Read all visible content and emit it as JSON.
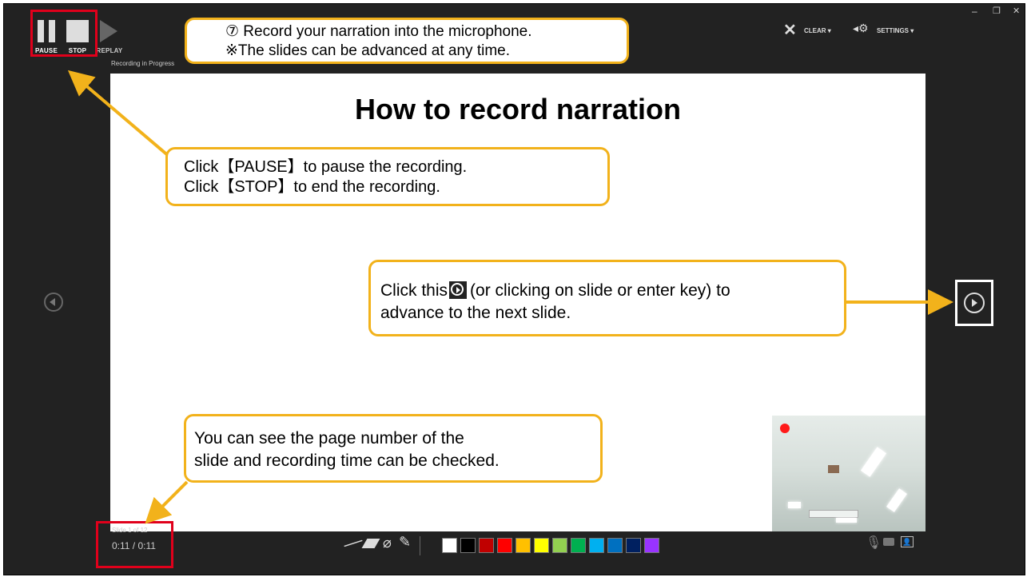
{
  "toolbar": {
    "pause_label": "PAUSE",
    "stop_label": "STOP",
    "replay_label": "REPLAY",
    "status_text": "Recording in Progress",
    "clear_label": "CLEAR ▾",
    "settings_label": "SETTINGS ▾"
  },
  "slide": {
    "title": "How to record narration"
  },
  "callouts": {
    "top_line1": "⑦  Record your narration into the microphone.",
    "top_line2": "※The slides can be advanced at any time.",
    "pause_line1": "Click【PAUSE】to pause the recording.",
    "pause_line2": "Click【STOP】to end the recording.",
    "next_prefix": "Click this",
    "next_suffix": "(or clicking on slide or enter key) to",
    "next_line2": "advance to the next slide.",
    "page_line1": "You can see the page number of the",
    "page_line2": "slide and recording time can be checked."
  },
  "status": {
    "slide_counter": "Slide 1 of 12",
    "time": "0:11 / 0:11"
  },
  "colors": {
    "accent": "#f2b21b",
    "highlight": "#e0001b",
    "swatches": [
      "#ffffff",
      "#000000",
      "#c00000",
      "#ff0000",
      "#ffc000",
      "#ffff00",
      "#92d050",
      "#00b050",
      "#00b0f0",
      "#0070c0",
      "#002060",
      "#9933ff"
    ]
  }
}
